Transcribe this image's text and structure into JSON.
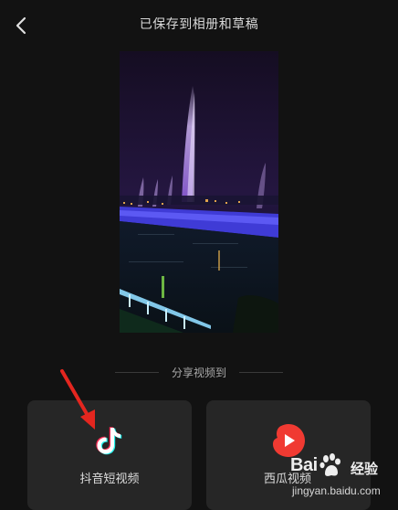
{
  "header": {
    "title": "已保存到相册和草稿",
    "back_icon": "chevron-left-icon"
  },
  "preview": {
    "description_icon": "video-thumbnail"
  },
  "share": {
    "title": "分享视频到",
    "targets": [
      {
        "label": "抖音短视频",
        "icon": "douyin-icon",
        "accent": "#25F4EE"
      },
      {
        "label": "西瓜视频",
        "icon": "xigua-icon",
        "accent": "#F03A32"
      }
    ]
  },
  "watermark": {
    "brand": "Bai",
    "brand_suffix": "经验",
    "url": "jingyan.baidu.com"
  },
  "colors": {
    "background": "#121212",
    "card": "#262626",
    "arrow": "#E4261F"
  }
}
